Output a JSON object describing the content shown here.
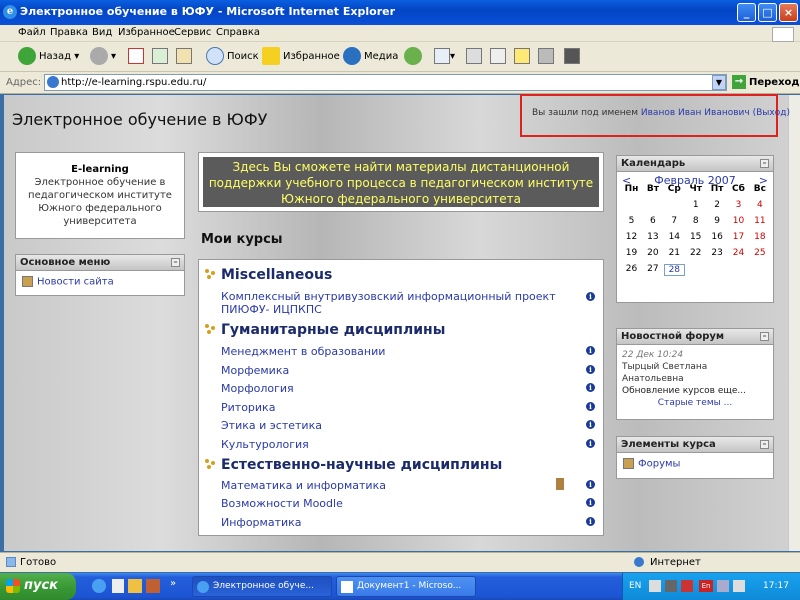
{
  "window": {
    "title": "Электронное обучение в ЮФУ - Microsoft Internet Explorer"
  },
  "menu": [
    "Файл",
    "Правка",
    "Вид",
    "Избранное",
    "Сервис",
    "Справка"
  ],
  "toolbar": {
    "back_label": "Назад",
    "search_label": "Поиск",
    "favorites_label": "Избранное",
    "media_label": "Медиа"
  },
  "address": {
    "label": "Адрес:",
    "url": "http://e-learning.rspu.edu.ru/",
    "go_label": "Переход"
  },
  "site": {
    "title": "Электронное обучение в ЮФУ",
    "login_prefix": "Вы зашли под именем",
    "user_name": "Иванов Иван Иванович",
    "logout": "(Выход)"
  },
  "elearning_block": {
    "heading": "E-learning",
    "text": "Электронное обучение в педагогическом институте Южного федерального университета"
  },
  "main_menu": {
    "title": "Основное меню",
    "item": "Новости сайта"
  },
  "intro_text": "Здесь Вы сможете найти материалы дистанционной поддержки учебного процесса в педагогическом институте Южного федерального университета",
  "my_courses": {
    "title": "Мои курсы",
    "categories": [
      {
        "name": "Miscellaneous",
        "courses": [
          "Комплексный внутривузовский информационный проект ПИЮФУ- ИЦПКПС"
        ]
      },
      {
        "name": "Гуманитарные дисциплины",
        "courses": [
          "Менеджмент в образовании",
          "Морфемика",
          "Морфология",
          "Риторика",
          "Этика и эстетика",
          "Культурология"
        ]
      },
      {
        "name": "Естественно-научные дисциплины",
        "courses": [
          "Математика и информатика",
          "Возможности Moodle",
          "Информатика"
        ]
      }
    ]
  },
  "calendar": {
    "title": "Календарь",
    "prev": "<",
    "next": ">",
    "month": "Февраль 2007",
    "weekdays": [
      "Пн",
      "Вт",
      "Ср",
      "Чт",
      "Пт",
      "Сб",
      "Вс"
    ],
    "weeks": [
      [
        "",
        "",
        "",
        "1",
        "2",
        "3",
        "4"
      ],
      [
        "5",
        "6",
        "7",
        "8",
        "9",
        "10",
        "11"
      ],
      [
        "12",
        "13",
        "14",
        "15",
        "16",
        "17",
        "18"
      ],
      [
        "19",
        "20",
        "21",
        "22",
        "23",
        "24",
        "25"
      ],
      [
        "26",
        "27",
        "28",
        "",
        "",
        "",
        ""
      ]
    ],
    "today": "28",
    "weekend_color": "#cc0000"
  },
  "news_forum": {
    "title": "Новостной форум",
    "date": "22 Дек 10:24",
    "author": "Тырцый Светлана Анатольевна",
    "subject": "Обновление курсов еще...",
    "older": "Старые темы ..."
  },
  "course_elements": {
    "title": "Элементы курса",
    "item": "Форумы"
  },
  "status": {
    "text": "Готово",
    "zone": "Интернет"
  },
  "taskbar": {
    "start": "пуск",
    "tasks": [
      "Электронное обуче...",
      "Документ1 - Microso..."
    ],
    "lang": "EN",
    "time": "17:17"
  },
  "colors": {
    "link": "#2a3aa8",
    "intro_bg": "#5b5b5b",
    "intro_text": "#ffff66",
    "highlight_border": "#dd2222"
  }
}
